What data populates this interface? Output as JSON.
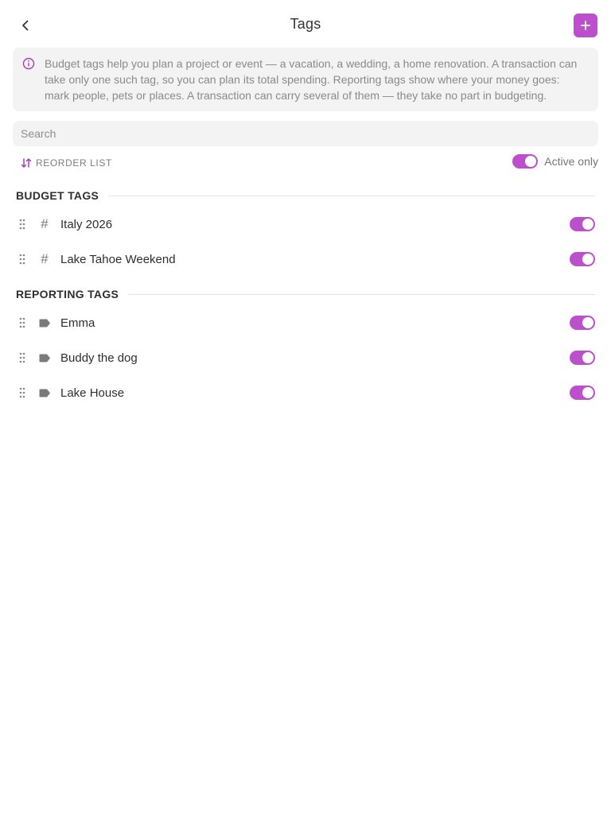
{
  "colors": {
    "accent": "#bb4fcc",
    "accent_text": "#a83bbb"
  },
  "header": {
    "title": "Tags",
    "back_icon": "chevron-left-icon",
    "add_icon": "plus-icon"
  },
  "info": {
    "icon": "info-icon",
    "text": "Budget tags help you plan a project or event — a vacation, a wedding, a home renovation. A transaction can take only one such tag, so you can plan its total spending. Reporting tags show where your money goes: mark people, pets or places. A transaction can carry several of them — they take no part in budgeting."
  },
  "search": {
    "placeholder": "Search",
    "value": ""
  },
  "toolbar": {
    "reorder_label": "REORDER LIST",
    "reorder_icon": "sort-arrows-icon",
    "active_only_label": "Active only",
    "active_only_on": true
  },
  "budget_section": {
    "title": "BUDGET TAGS",
    "items": [
      {
        "label": "Italy 2026",
        "icon": "hash-icon",
        "active": true
      },
      {
        "label": "Lake Tahoe Weekend",
        "icon": "hash-icon",
        "active": true
      }
    ]
  },
  "reporting_section": {
    "title": "REPORTING TAGS",
    "items": [
      {
        "label": "Emma",
        "icon": "label-tag-icon",
        "active": true
      },
      {
        "label": "Buddy the dog",
        "icon": "label-tag-icon",
        "active": true
      },
      {
        "label": "Lake House",
        "icon": "label-tag-icon",
        "active": true
      }
    ]
  }
}
